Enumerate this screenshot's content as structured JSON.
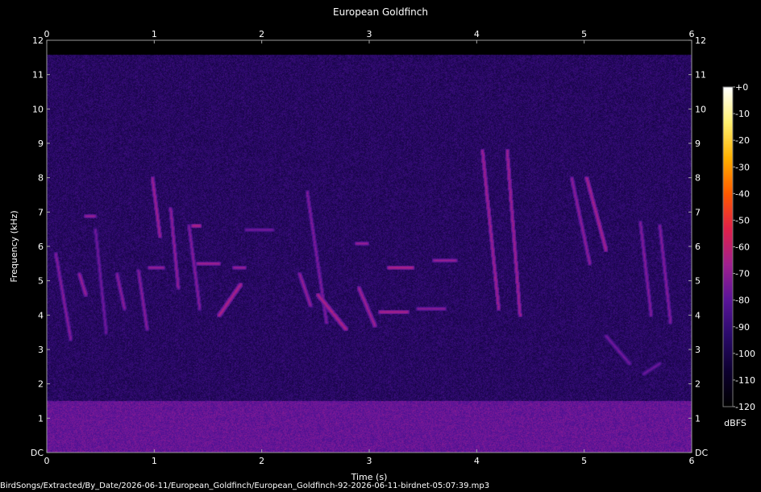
{
  "file_path": "BirdSongs/Extracted/By_Date/2026-06-11/European_Goldfinch/European_Goldfinch-92-2026-06-11-birdnet-05:07:39.mp3",
  "chart_data": {
    "type": "heatmap",
    "title": "European Goldfinch",
    "xlabel": "Time (s)",
    "ylabel": "Frequency (kHz)",
    "xlim": [
      0,
      6
    ],
    "ylim": [
      0,
      12
    ],
    "x_ticks": [
      "0",
      "1",
      "2",
      "3",
      "4",
      "5",
      "6"
    ],
    "y_ticks": [
      "DC",
      "1",
      "2",
      "3",
      "4",
      "5",
      "6",
      "7",
      "8",
      "9",
      "10",
      "11",
      "12"
    ],
    "colorbar": {
      "label": "dBFS",
      "range": [
        -120,
        0
      ],
      "ticks": [
        "+0",
        "-10",
        "-20",
        "-30",
        "-40",
        "-50",
        "-60",
        "-70",
        "-80",
        "-90",
        "-100",
        "-110",
        "-120"
      ],
      "colors": [
        "#000000",
        "#0d0030",
        "#2a0a6a",
        "#5a1499",
        "#a02090",
        "#e0204a",
        "#ff5a00",
        "#ffb000",
        "#fff070",
        "#ffffff"
      ]
    },
    "background_level_dbfs": -95,
    "low_band": {
      "freq_khz": [
        0,
        1.5
      ],
      "level_dbfs": -78
    },
    "calls": [
      {
        "t": [
          0.08,
          0.22
        ],
        "f": [
          5.8,
          3.3
        ],
        "level_dbfs": -72
      },
      {
        "t": [
          0.3,
          0.36
        ],
        "f": [
          5.2,
          4.6
        ],
        "level_dbfs": -70
      },
      {
        "t": [
          0.36,
          0.44
        ],
        "f": [
          6.9,
          6.9
        ],
        "level_dbfs": -70
      },
      {
        "t": [
          0.45,
          0.55
        ],
        "f": [
          6.5,
          3.5
        ],
        "level_dbfs": -75
      },
      {
        "t": [
          0.65,
          0.72
        ],
        "f": [
          5.2,
          4.2
        ],
        "level_dbfs": -72
      },
      {
        "t": [
          0.85,
          0.93
        ],
        "f": [
          5.3,
          3.6
        ],
        "level_dbfs": -72
      },
      {
        "t": [
          0.95,
          1.08
        ],
        "f": [
          5.4,
          5.4
        ],
        "level_dbfs": -70
      },
      {
        "t": [
          0.98,
          1.05
        ],
        "f": [
          8.0,
          6.3
        ],
        "level_dbfs": -68
      },
      {
        "t": [
          1.15,
          1.22
        ],
        "f": [
          7.1,
          4.8
        ],
        "level_dbfs": -70
      },
      {
        "t": [
          1.32,
          1.42
        ],
        "f": [
          6.6,
          4.2
        ],
        "level_dbfs": -72
      },
      {
        "t": [
          1.4,
          1.6
        ],
        "f": [
          5.5,
          5.5
        ],
        "level_dbfs": -68
      },
      {
        "t": [
          1.36,
          1.42
        ],
        "f": [
          6.6,
          6.6
        ],
        "level_dbfs": -65
      },
      {
        "t": [
          1.6,
          1.8
        ],
        "f": [
          4.0,
          4.9
        ],
        "level_dbfs": -65
      },
      {
        "t": [
          1.74,
          1.84
        ],
        "f": [
          5.4,
          5.4
        ],
        "level_dbfs": -70
      },
      {
        "t": [
          1.85,
          2.1
        ],
        "f": [
          6.5,
          6.5
        ],
        "level_dbfs": -76
      },
      {
        "t": [
          2.35,
          2.45
        ],
        "f": [
          5.2,
          4.3
        ],
        "level_dbfs": -70
      },
      {
        "t": [
          2.42,
          2.6
        ],
        "f": [
          7.6,
          3.8
        ],
        "level_dbfs": -72
      },
      {
        "t": [
          2.52,
          2.78
        ],
        "f": [
          4.6,
          3.6
        ],
        "level_dbfs": -65
      },
      {
        "t": [
          2.88,
          2.98
        ],
        "f": [
          6.1,
          6.1
        ],
        "level_dbfs": -70
      },
      {
        "t": [
          2.9,
          3.05
        ],
        "f": [
          4.8,
          3.7
        ],
        "level_dbfs": -68
      },
      {
        "t": [
          3.1,
          3.35
        ],
        "f": [
          4.1,
          4.1
        ],
        "level_dbfs": -66
      },
      {
        "t": [
          3.18,
          3.4
        ],
        "f": [
          5.4,
          5.4
        ],
        "level_dbfs": -65
      },
      {
        "t": [
          3.45,
          3.7
        ],
        "f": [
          4.2,
          4.2
        ],
        "level_dbfs": -72
      },
      {
        "t": [
          3.6,
          3.8
        ],
        "f": [
          5.6,
          5.6
        ],
        "level_dbfs": -70
      },
      {
        "t": [
          4.05,
          4.2
        ],
        "f": [
          8.8,
          4.2
        ],
        "level_dbfs": -66
      },
      {
        "t": [
          4.28,
          4.4
        ],
        "f": [
          8.8,
          4.0
        ],
        "level_dbfs": -66
      },
      {
        "t": [
          5.02,
          5.2
        ],
        "f": [
          8.0,
          5.9
        ],
        "level_dbfs": -66
      },
      {
        "t": [
          4.88,
          5.05
        ],
        "f": [
          8.0,
          5.5
        ],
        "level_dbfs": -70
      },
      {
        "t": [
          5.52,
          5.62
        ],
        "f": [
          6.7,
          4.0
        ],
        "level_dbfs": -72
      },
      {
        "t": [
          5.7,
          5.8
        ],
        "f": [
          6.6,
          3.8
        ],
        "level_dbfs": -72
      },
      {
        "t": [
          5.2,
          5.42
        ],
        "f": [
          3.4,
          2.6
        ],
        "level_dbfs": -76
      },
      {
        "t": [
          5.55,
          5.7
        ],
        "f": [
          2.3,
          2.6
        ],
        "level_dbfs": -78
      }
    ]
  }
}
